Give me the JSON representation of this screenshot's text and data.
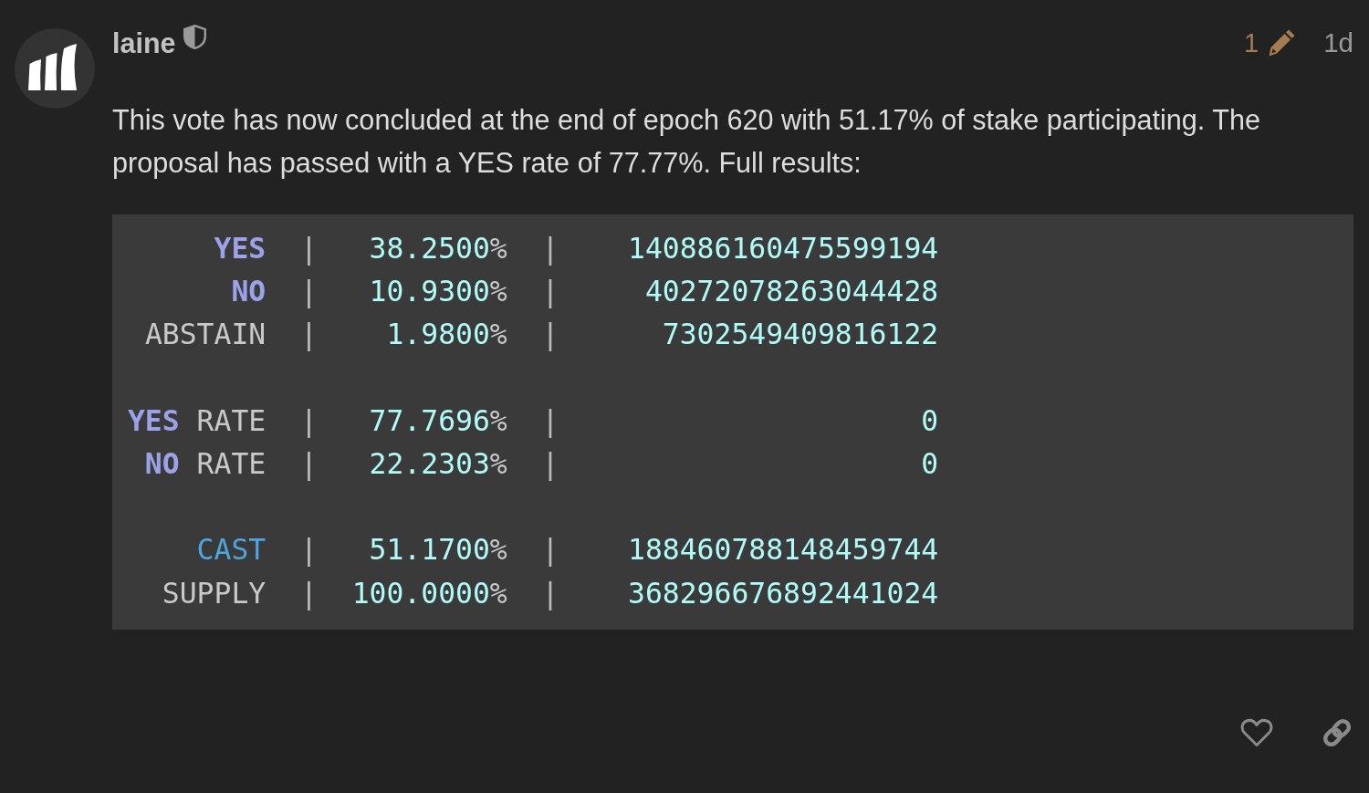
{
  "post": {
    "author": {
      "username": "laine"
    },
    "edit_count": "1",
    "age": "1d",
    "body": "This vote has now concluded at the end of epoch 620 with 51.17% of stake participating. The proposal has passed with a YES rate of 77.77%. Full results:",
    "results_block": {
      "rows": [
        {
          "kind": "data",
          "label": [
            {
              "text": "YES",
              "kind": "keyword"
            }
          ],
          "separator_1": "|",
          "share": {
            "value": "38.2500",
            "unit": "%"
          },
          "separator_2": "|",
          "amount": "140886160475599194"
        },
        {
          "kind": "data",
          "label": [
            {
              "text": "NO",
              "kind": "keyword"
            }
          ],
          "separator_1": "|",
          "share": {
            "value": "10.9300",
            "unit": "%"
          },
          "separator_2": "|",
          "amount": "40272078263044428"
        },
        {
          "kind": "data",
          "label": [
            {
              "text": "ABSTAIN",
              "kind": "plain"
            }
          ],
          "separator_1": "|",
          "share": {
            "value": "1.9800",
            "unit": "%"
          },
          "separator_2": "|",
          "amount": "7302549409816122"
        },
        {
          "kind": "blank"
        },
        {
          "kind": "data",
          "label": [
            {
              "text": "YES",
              "kind": "keyword"
            },
            {
              "text": "RATE",
              "kind": "plain"
            }
          ],
          "separator_1": "|",
          "share": {
            "value": "77.7696",
            "unit": "%"
          },
          "separator_2": "|",
          "amount": "0"
        },
        {
          "kind": "data",
          "label": [
            {
              "text": "NO",
              "kind": "keyword"
            },
            {
              "text": "RATE",
              "kind": "plain"
            }
          ],
          "separator_1": "|",
          "share": {
            "value": "22.2303",
            "unit": "%"
          },
          "separator_2": "|",
          "amount": "0"
        },
        {
          "kind": "blank"
        },
        {
          "kind": "data",
          "label": [
            {
              "text": "CAST",
              "kind": "builtin"
            }
          ],
          "separator_1": "|",
          "share": {
            "value": "51.1700",
            "unit": "%"
          },
          "separator_2": "|",
          "amount": "188460788148459744"
        },
        {
          "kind": "data",
          "label": [
            {
              "text": "SUPPLY",
              "kind": "plain"
            }
          ],
          "separator_1": "|",
          "share": {
            "value": "100.0000",
            "unit": "%"
          },
          "separator_2": "|",
          "amount": "368296676892441024"
        }
      ]
    }
  }
}
